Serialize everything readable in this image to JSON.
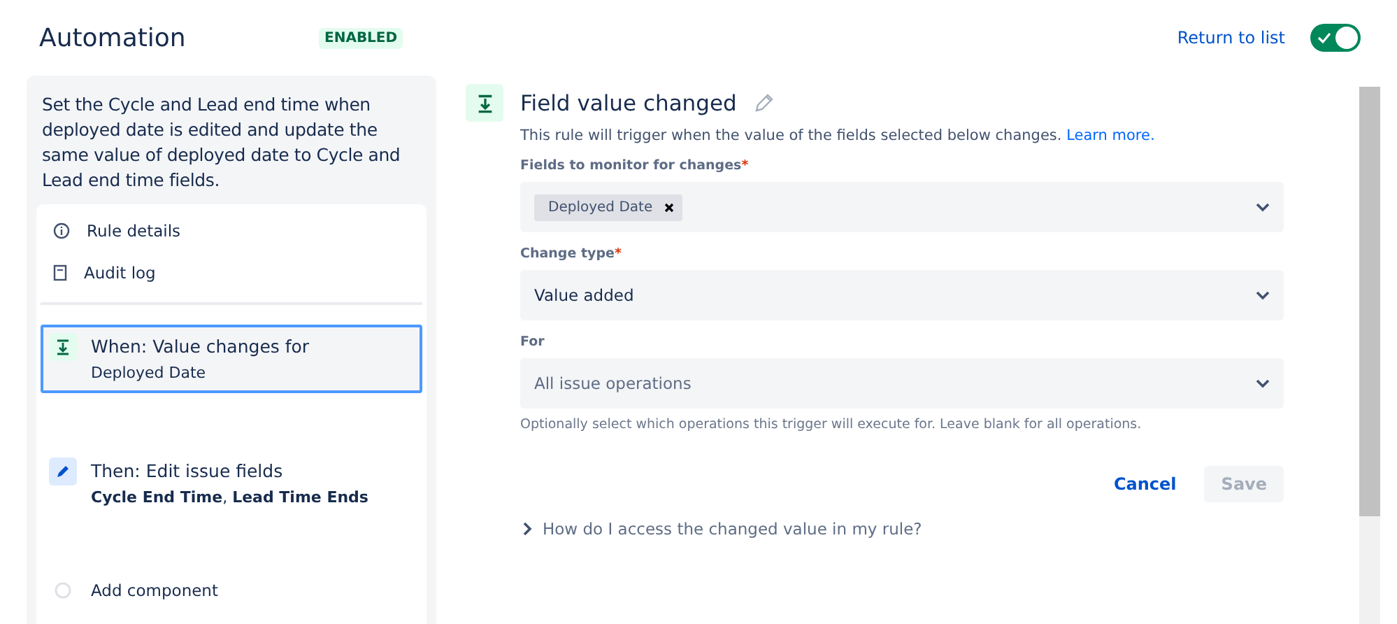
{
  "header": {
    "title": "Automation",
    "status_badge": "ENABLED",
    "return_link": "Return to list",
    "toggle": {
      "on": true
    }
  },
  "sidebar": {
    "description": "Set the Cycle and Lead end time when deployed date is edited and update the same value of deployed date to Cycle and Lead end time fields.",
    "menu": [
      {
        "kind": "info",
        "label": "Rule details"
      },
      {
        "kind": "log",
        "label": "Audit log"
      }
    ],
    "components": [
      {
        "kind": "trigger",
        "title": "When: Value changes for",
        "detail": "Deployed Date",
        "selected": true
      },
      {
        "kind": "action",
        "title": "Then: Edit issue fields",
        "detail": "**Cycle End Time**, **Lead Time Ends**",
        "selected": false
      },
      {
        "kind": "add",
        "title": "Add component",
        "selected": false
      }
    ]
  },
  "editor": {
    "title": "Field value changed",
    "description": "This rule will trigger when the value of the fields selected below changes.",
    "learn_more": "Learn more.",
    "fields": [
      {
        "label": "Fields to monitor for changes",
        "required_mark": "*",
        "tags": [
          "Deployed Date"
        ]
      },
      {
        "label": "Change type",
        "required_mark": "*",
        "value": "Value added"
      },
      {
        "label": "For",
        "placeholder": "All issue operations",
        "help": "Optionally select which operations this trigger will execute for. Leave blank for all operations."
      }
    ],
    "cancel": "Cancel",
    "save": {
      "label": "Save",
      "disabled": true
    },
    "faq": {
      "label": "How do I access the changed value in my rule?",
      "expanded": false
    }
  }
}
